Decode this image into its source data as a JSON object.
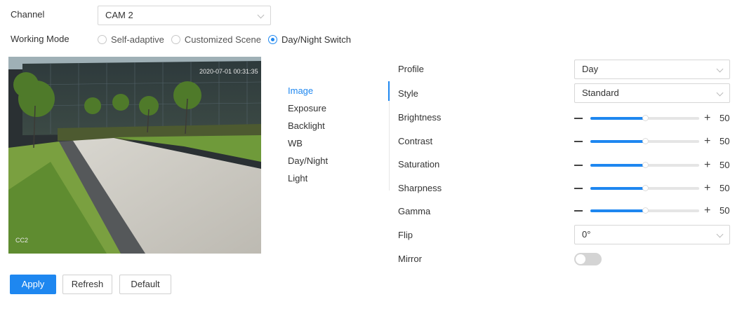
{
  "channel": {
    "label": "Channel",
    "value": "CAM 2"
  },
  "working_mode": {
    "label": "Working Mode",
    "options": [
      "Self-adaptive",
      "Customized Scene",
      "Day/Night Switch"
    ],
    "selected": "Day/Night Switch"
  },
  "preview": {
    "timestamp": "2020-07-01 00:31:35",
    "cam_label": "CC2"
  },
  "menu": {
    "items": [
      "Image",
      "Exposure",
      "Backlight",
      "WB",
      "Day/Night",
      "Light"
    ],
    "active": "Image"
  },
  "settings": {
    "profile": {
      "label": "Profile",
      "value": "Day"
    },
    "style": {
      "label": "Style",
      "value": "Standard"
    },
    "sliders": [
      {
        "label": "Brightness",
        "value": 50
      },
      {
        "label": "Contrast",
        "value": 50
      },
      {
        "label": "Saturation",
        "value": 50
      },
      {
        "label": "Sharpness",
        "value": 50
      },
      {
        "label": "Gamma",
        "value": 50
      }
    ],
    "flip": {
      "label": "Flip",
      "value": "0°"
    },
    "mirror": {
      "label": "Mirror",
      "enabled": false
    }
  },
  "buttons": {
    "apply": "Apply",
    "refresh": "Refresh",
    "default": "Default"
  },
  "colors": {
    "accent": "#1e87f0",
    "toggle_off": "#d4d4d4"
  }
}
